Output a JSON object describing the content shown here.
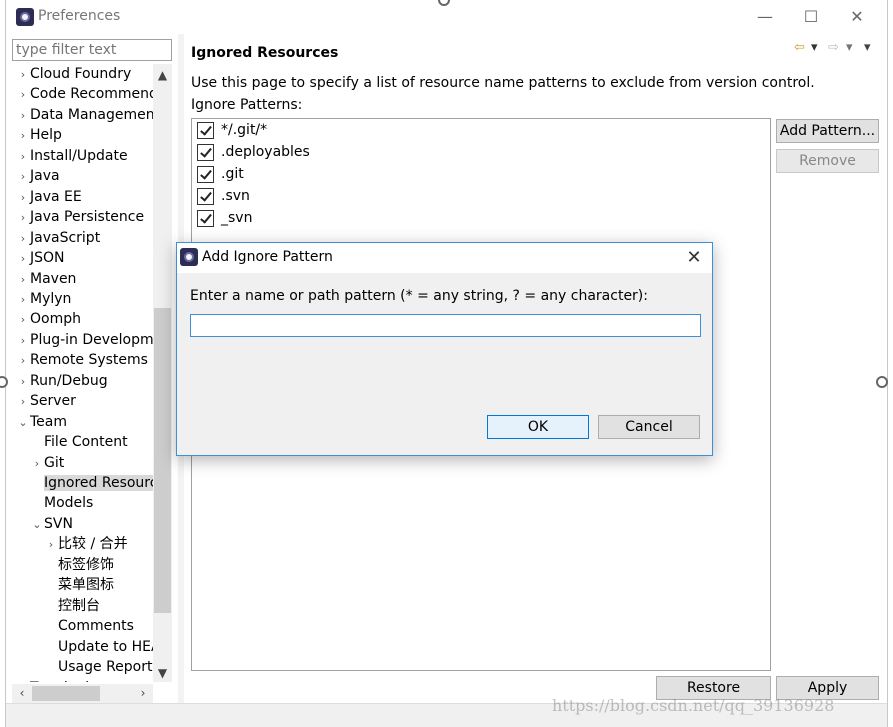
{
  "window": {
    "title": "Preferences",
    "minimize_glyph": "—",
    "maximize_glyph": "☐",
    "close_glyph": "✕"
  },
  "sidebar": {
    "filter_placeholder": "type filter text",
    "items": [
      {
        "label": "Cloud Foundry",
        "arrow": "›",
        "level": 0
      },
      {
        "label": "Code Recommende",
        "arrow": "›",
        "level": 0
      },
      {
        "label": "Data Management",
        "arrow": "›",
        "level": 0
      },
      {
        "label": "Help",
        "arrow": "›",
        "level": 0
      },
      {
        "label": "Install/Update",
        "arrow": "›",
        "level": 0
      },
      {
        "label": "Java",
        "arrow": "›",
        "level": 0
      },
      {
        "label": "Java EE",
        "arrow": "›",
        "level": 0
      },
      {
        "label": "Java Persistence",
        "arrow": "›",
        "level": 0
      },
      {
        "label": "JavaScript",
        "arrow": "›",
        "level": 0
      },
      {
        "label": "JSON",
        "arrow": "›",
        "level": 0
      },
      {
        "label": "Maven",
        "arrow": "›",
        "level": 0
      },
      {
        "label": "Mylyn",
        "arrow": "›",
        "level": 0
      },
      {
        "label": "Oomph",
        "arrow": "›",
        "level": 0
      },
      {
        "label": "Plug-in Developme",
        "arrow": "›",
        "level": 0
      },
      {
        "label": "Remote Systems",
        "arrow": "›",
        "level": 0
      },
      {
        "label": "Run/Debug",
        "arrow": "›",
        "level": 0
      },
      {
        "label": "Server",
        "arrow": "›",
        "level": 0
      },
      {
        "label": "Team",
        "arrow": "⌄",
        "level": 0
      },
      {
        "label": "File Content",
        "arrow": "",
        "level": 1
      },
      {
        "label": "Git",
        "arrow": "›",
        "level": 1
      },
      {
        "label": "Ignored Resourc",
        "arrow": "",
        "level": 1,
        "selected": true
      },
      {
        "label": "Models",
        "arrow": "",
        "level": 1
      },
      {
        "label": "SVN",
        "arrow": "⌄",
        "level": 1
      },
      {
        "label": "比较 / 合并",
        "arrow": "›",
        "level": 2
      },
      {
        "label": "标签修饰",
        "arrow": "",
        "level": 2
      },
      {
        "label": "菜单图标",
        "arrow": "",
        "level": 2
      },
      {
        "label": "控制台",
        "arrow": "",
        "level": 2
      },
      {
        "label": "Comments",
        "arrow": "",
        "level": 2
      },
      {
        "label": "Update to HEA",
        "arrow": "",
        "level": 2
      },
      {
        "label": "Usage Reporti",
        "arrow": "",
        "level": 2
      },
      {
        "label": "Terminal",
        "arrow": "›",
        "level": 0
      }
    ]
  },
  "page": {
    "title": "Ignored Resources",
    "description": "Use this page to specify a list of resource name patterns to exclude from version control.",
    "patterns_label": "Ignore Patterns:",
    "patterns": [
      {
        "text": "*/.git/*",
        "checked": true
      },
      {
        "text": ".deployables",
        "checked": true
      },
      {
        "text": ".git",
        "checked": true
      },
      {
        "text": ".svn",
        "checked": true
      },
      {
        "text": "_svn",
        "checked": true
      }
    ],
    "add_button": "Add Pattern...",
    "remove_button": "Remove",
    "restore_button": "Restore Defaults",
    "apply_button": "Apply"
  },
  "dialog": {
    "title": "Add Ignore Pattern",
    "prompt": "Enter a name or path pattern (* = any string, ? = any character):",
    "input_value": "",
    "ok_label": "OK",
    "cancel_label": "Cancel",
    "close_glyph": "✕"
  },
  "watermark": "https://blog.csdn.net/qq_39136928"
}
